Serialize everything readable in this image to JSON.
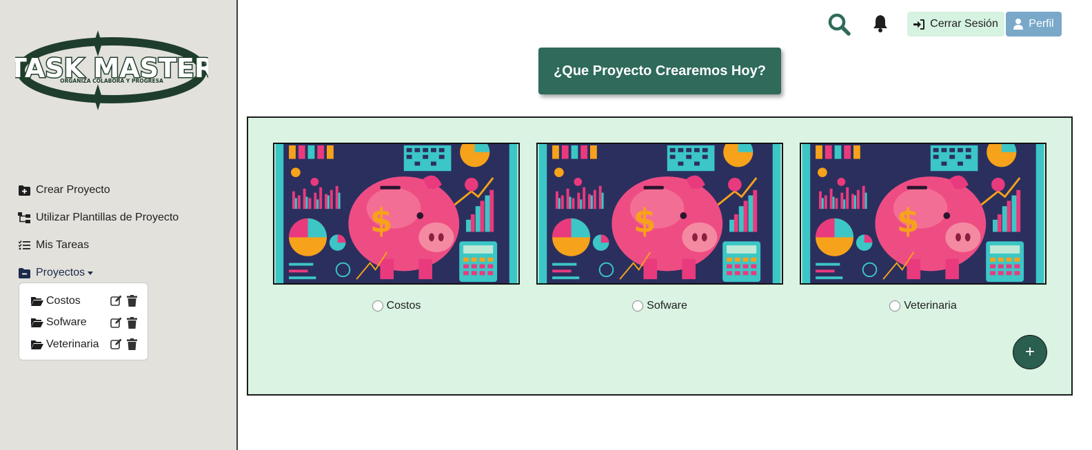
{
  "app": {
    "logo_title": "TASK MASTER",
    "logo_tagline": "ORGANIZA COLABORA Y PROGRESA"
  },
  "sidebar": {
    "items": [
      {
        "label": "Crear Proyecto",
        "icon": "folder-plus-icon"
      },
      {
        "label": "Utilizar Plantillas de Proyecto",
        "icon": "sitemap-icon"
      },
      {
        "label": "Mis Tareas",
        "icon": "task-list-icon"
      },
      {
        "label": "Proyectos",
        "icon": "folder-minus-icon"
      }
    ],
    "projects": [
      {
        "name": "Costos"
      },
      {
        "name": "Sofware"
      },
      {
        "name": "Veterinaria"
      }
    ]
  },
  "header": {
    "logout_label": "Cerrar Sesión",
    "profile_label": "Perfil"
  },
  "main": {
    "hero_label": "¿Que Proyecto Crearemos Hoy?",
    "cards": [
      {
        "label": "Costos"
      },
      {
        "label": "Sofware"
      },
      {
        "label": "Veterinaria"
      }
    ],
    "add_label": "+"
  },
  "colors": {
    "sidebar_bg": "#e2e1dc",
    "accent_green": "#2f6a5b",
    "panel_bg": "#daf3e2",
    "logout_bg": "#d6f2e1",
    "profile_bg": "#79a8c9"
  }
}
